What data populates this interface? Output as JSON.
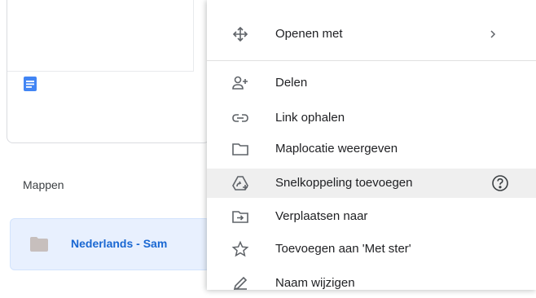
{
  "sidebar": {
    "section_label": "Mappen",
    "folder_name": "Nederlands - Sam"
  },
  "context_menu": {
    "items": [
      {
        "label": "Openen met",
        "icon": "move-arrows-icon",
        "has_submenu": true
      },
      {
        "label": "Delen",
        "icon": "person-add-icon"
      },
      {
        "label": "Link ophalen",
        "icon": "link-icon"
      },
      {
        "label": "Maplocatie weergeven",
        "icon": "folder-outline-icon"
      },
      {
        "label": "Snelkoppeling toevoegen",
        "icon": "add-shortcut-icon",
        "highlighted": true,
        "has_help": true
      },
      {
        "label": "Verplaatsen naar",
        "icon": "move-to-icon"
      },
      {
        "label": "Toevoegen aan 'Met ster'",
        "icon": "star-icon"
      },
      {
        "label": "Naam wijzigen",
        "icon": "pencil-icon"
      }
    ]
  },
  "colors": {
    "accent": "#1967d2",
    "doc_blue": "#4285f4",
    "folder_gray": "#c7bfbd",
    "selected_bg": "#e8f0fe",
    "hover_bg": "#efefef"
  }
}
